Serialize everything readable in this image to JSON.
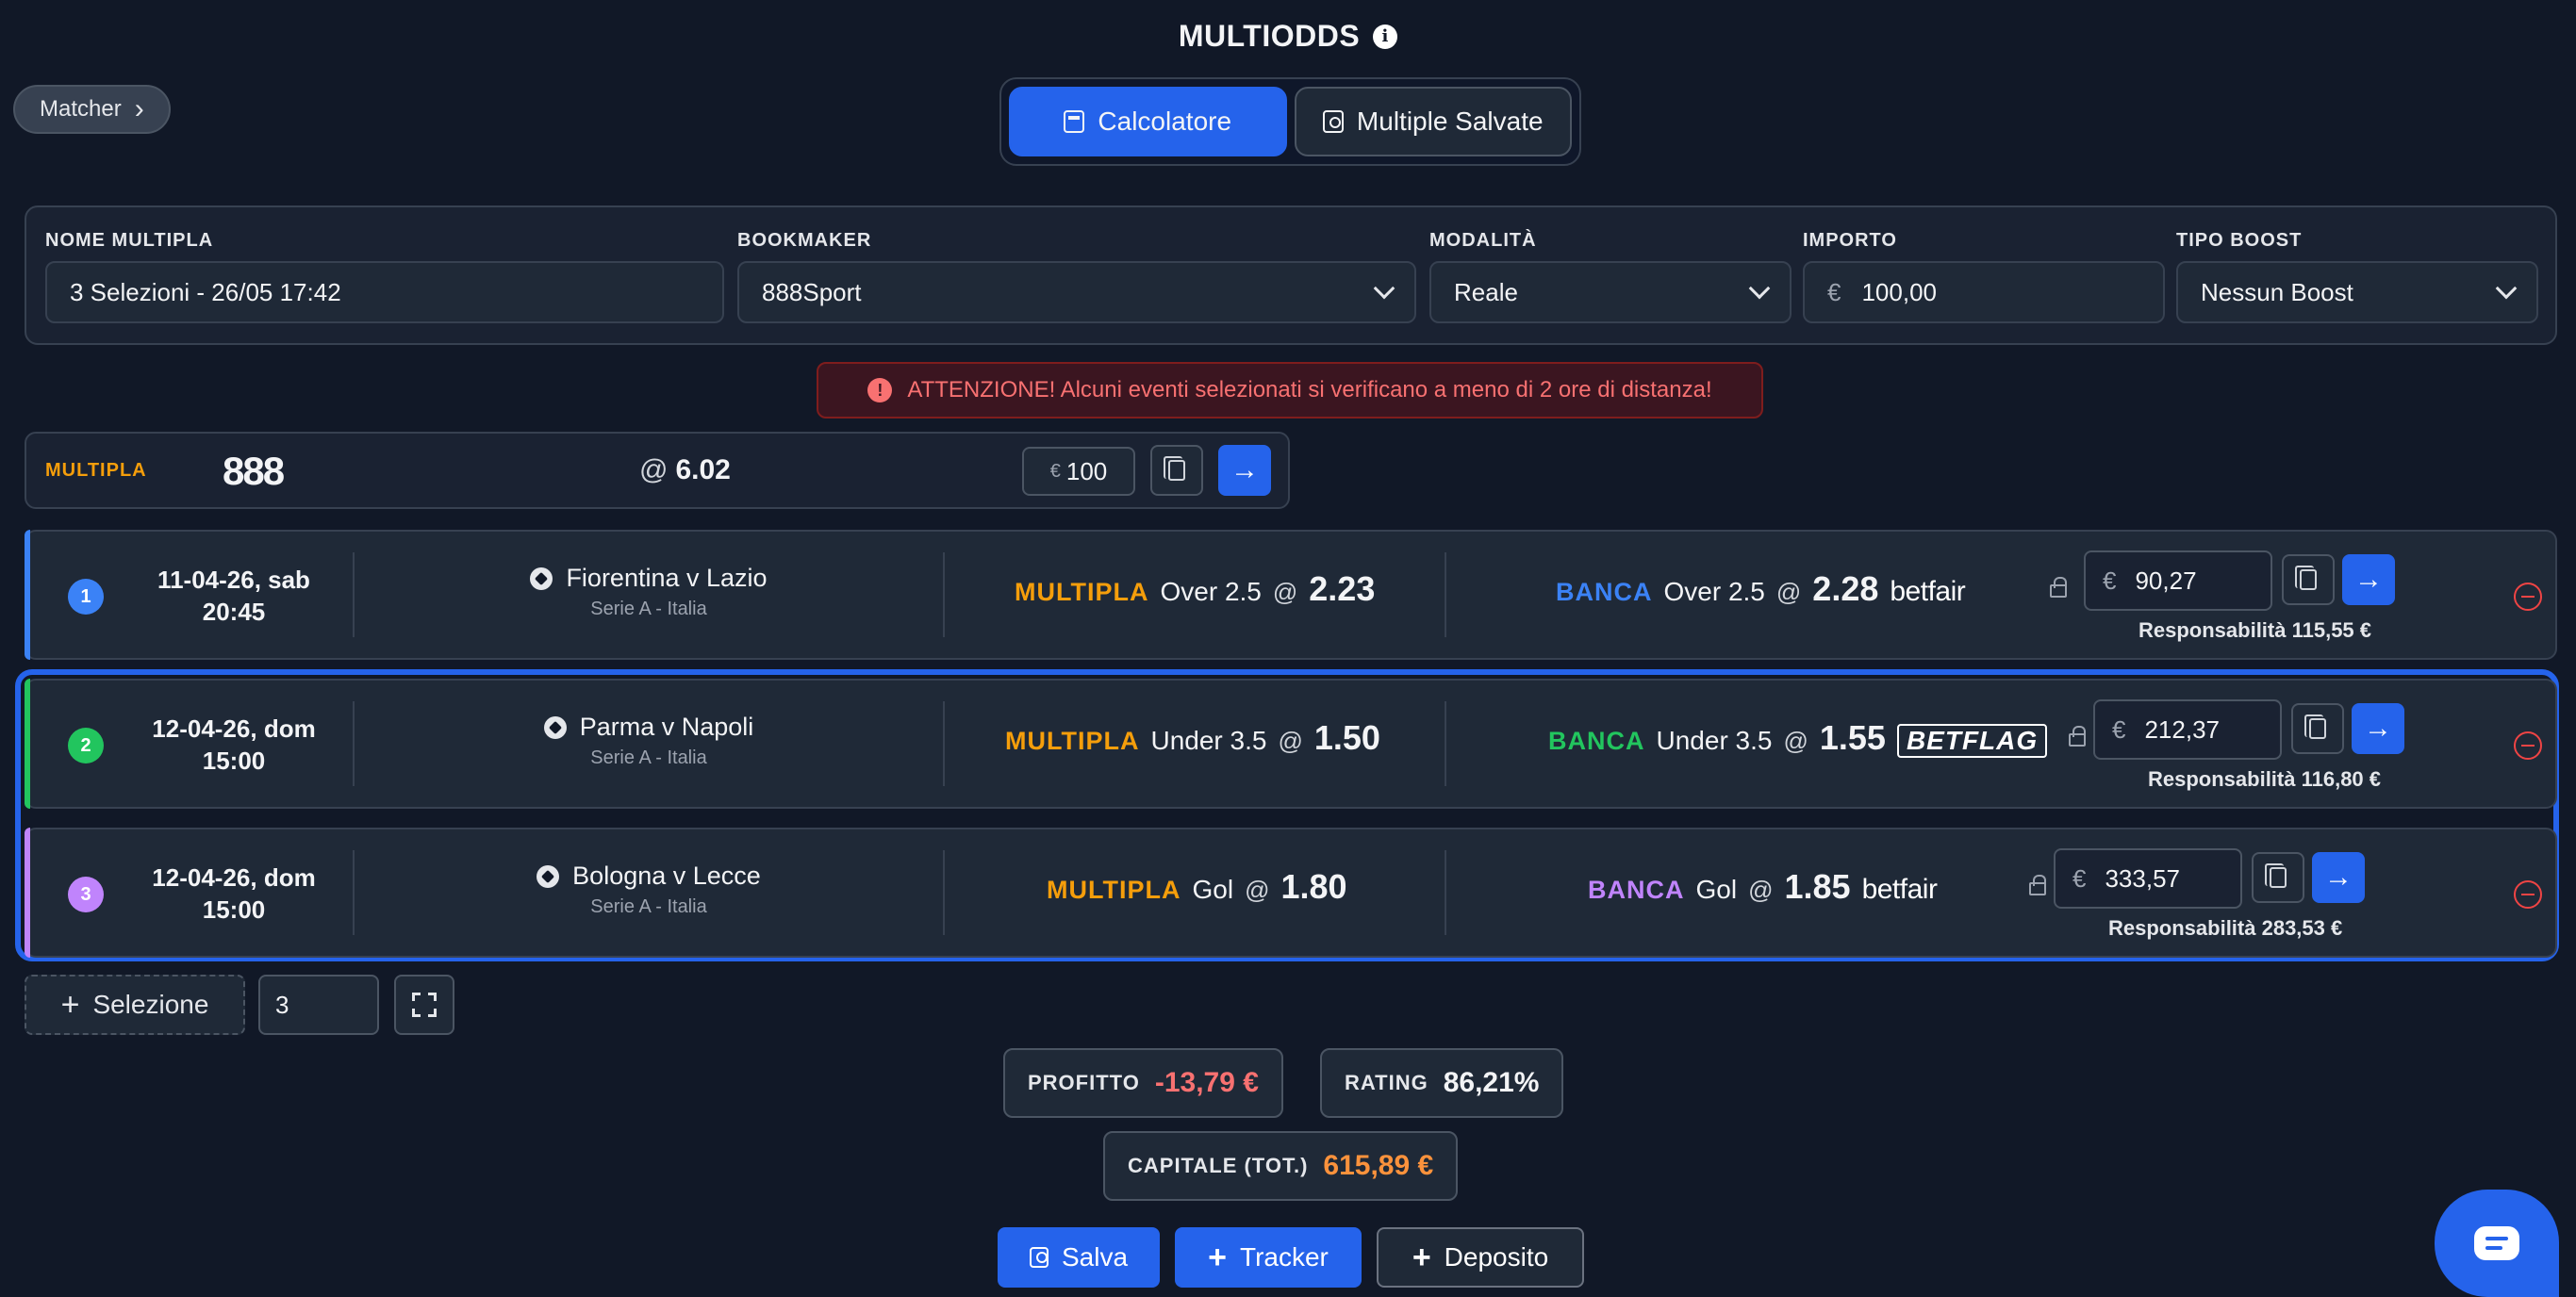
{
  "header": {
    "title": "MULTIODDS",
    "info_icon": "info-icon"
  },
  "matcher": {
    "label": "Matcher"
  },
  "tabs": [
    {
      "label": "Calcolatore",
      "icon": "calculator-icon",
      "active": true
    },
    {
      "label": "Multiple Salvate",
      "icon": "save-icon",
      "active": false
    }
  ],
  "form": {
    "name": {
      "label": "NOME MULTIPLA",
      "value": "3 Selezioni - 26/05 17:42"
    },
    "bookmaker": {
      "label": "BOOKMAKER",
      "value": "888Sport"
    },
    "mode": {
      "label": "MODALITÀ",
      "value": "Reale"
    },
    "amount": {
      "label": "IMPORTO",
      "currency": "€",
      "value": "100,00"
    },
    "boost": {
      "label": "TIPO BOOST",
      "value": "Nessun Boost"
    }
  },
  "warning": "ATTENZIONE! Alcuni eventi selezionati si verificano a meno di 2 ore di distanza!",
  "multipla": {
    "label": "MULTIPLA",
    "logo": "888",
    "at": "@",
    "odds": "6.02",
    "currency": "€",
    "stake": "100"
  },
  "rows": [
    {
      "num": "1",
      "date": "11-04-26, sab",
      "time": "20:45",
      "match": "Fiorentina v Lazio",
      "league": "Serie A - Italia",
      "back_label": "MULTIPLA",
      "back_market": "Over 2.5",
      "at": "@",
      "back_odds": "2.23",
      "lay_label": "BANCA",
      "lay_market": "Over 2.5",
      "lay_odds": "2.28",
      "exchange": "betfair",
      "currency": "€",
      "stake": "90,27",
      "responsibility": "Responsabilità 115,55 €",
      "color": "#3b82f6"
    },
    {
      "num": "2",
      "date": "12-04-26, dom",
      "time": "15:00",
      "match": "Parma v Napoli",
      "league": "Serie A - Italia",
      "back_label": "MULTIPLA",
      "back_market": "Under 3.5",
      "at": "@",
      "back_odds": "1.50",
      "lay_label": "BANCA",
      "lay_market": "Under 3.5",
      "lay_odds": "1.55",
      "exchange": "BETFLAG",
      "currency": "€",
      "stake": "212,37",
      "responsibility": "Responsabilità 116,80 €",
      "color": "#22c55e"
    },
    {
      "num": "3",
      "date": "12-04-26, dom",
      "time": "15:00",
      "match": "Bologna v Lecce",
      "league": "Serie A - Italia",
      "back_label": "MULTIPLA",
      "back_market": "Gol",
      "at": "@",
      "back_odds": "1.80",
      "lay_label": "BANCA",
      "lay_market": "Gol",
      "lay_odds": "1.85",
      "exchange": "betfair",
      "currency": "€",
      "stake": "333,57",
      "responsibility": "Responsabilità 283,53 €",
      "color": "#c084fc"
    }
  ],
  "controls": {
    "add_selection": "Selezione",
    "selection_count": "3"
  },
  "stats": {
    "profit_label": "PROFITTO",
    "profit_value": "-13,79 €",
    "rating_label": "RATING",
    "rating_value": "86,21%",
    "capital_label": "CAPITALE (TOT.)",
    "capital_value": "615,89 €"
  },
  "actions": {
    "save": "Salva",
    "tracker": "Tracker",
    "deposit": "Deposito"
  },
  "colors": {
    "accent": "#2563eb",
    "orange": "#f59e0b",
    "negative": "#f87171",
    "capital": "#fb923c"
  }
}
